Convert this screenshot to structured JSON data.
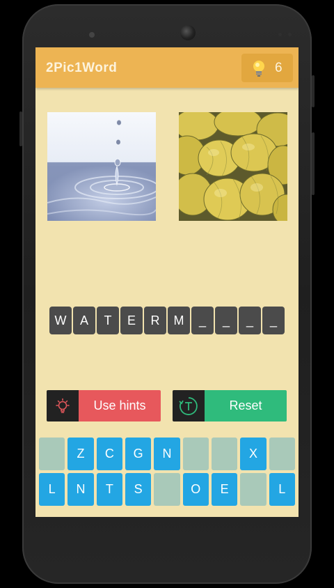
{
  "app": {
    "title": "2Pic1Word"
  },
  "hints": {
    "count": "6",
    "icon": "lightbulb-icon"
  },
  "pictures": [
    {
      "name": "water-drop-image",
      "description": "water drop"
    },
    {
      "name": "melons-image",
      "description": "melons"
    }
  ],
  "answer": {
    "letters": [
      "W",
      "A",
      "T",
      "E",
      "R",
      "M",
      "_",
      "_",
      "_",
      "_"
    ]
  },
  "actions": {
    "use_hints_label": "Use hints",
    "reset_label": "Reset"
  },
  "keyboard": {
    "row1": [
      "",
      "Z",
      "C",
      "G",
      "N",
      "",
      "",
      "X",
      ""
    ],
    "row2": [
      "L",
      "N",
      "T",
      "S",
      "",
      "O",
      "E",
      "",
      "L"
    ]
  },
  "colors": {
    "appbar": "#edb453",
    "background": "#f2e3af",
    "tile": "#4b4b4b",
    "hint_button": "#e7585c",
    "reset_button": "#2fbb7c",
    "key_active": "#23a6e3",
    "key_used": "#a9c9b9"
  }
}
